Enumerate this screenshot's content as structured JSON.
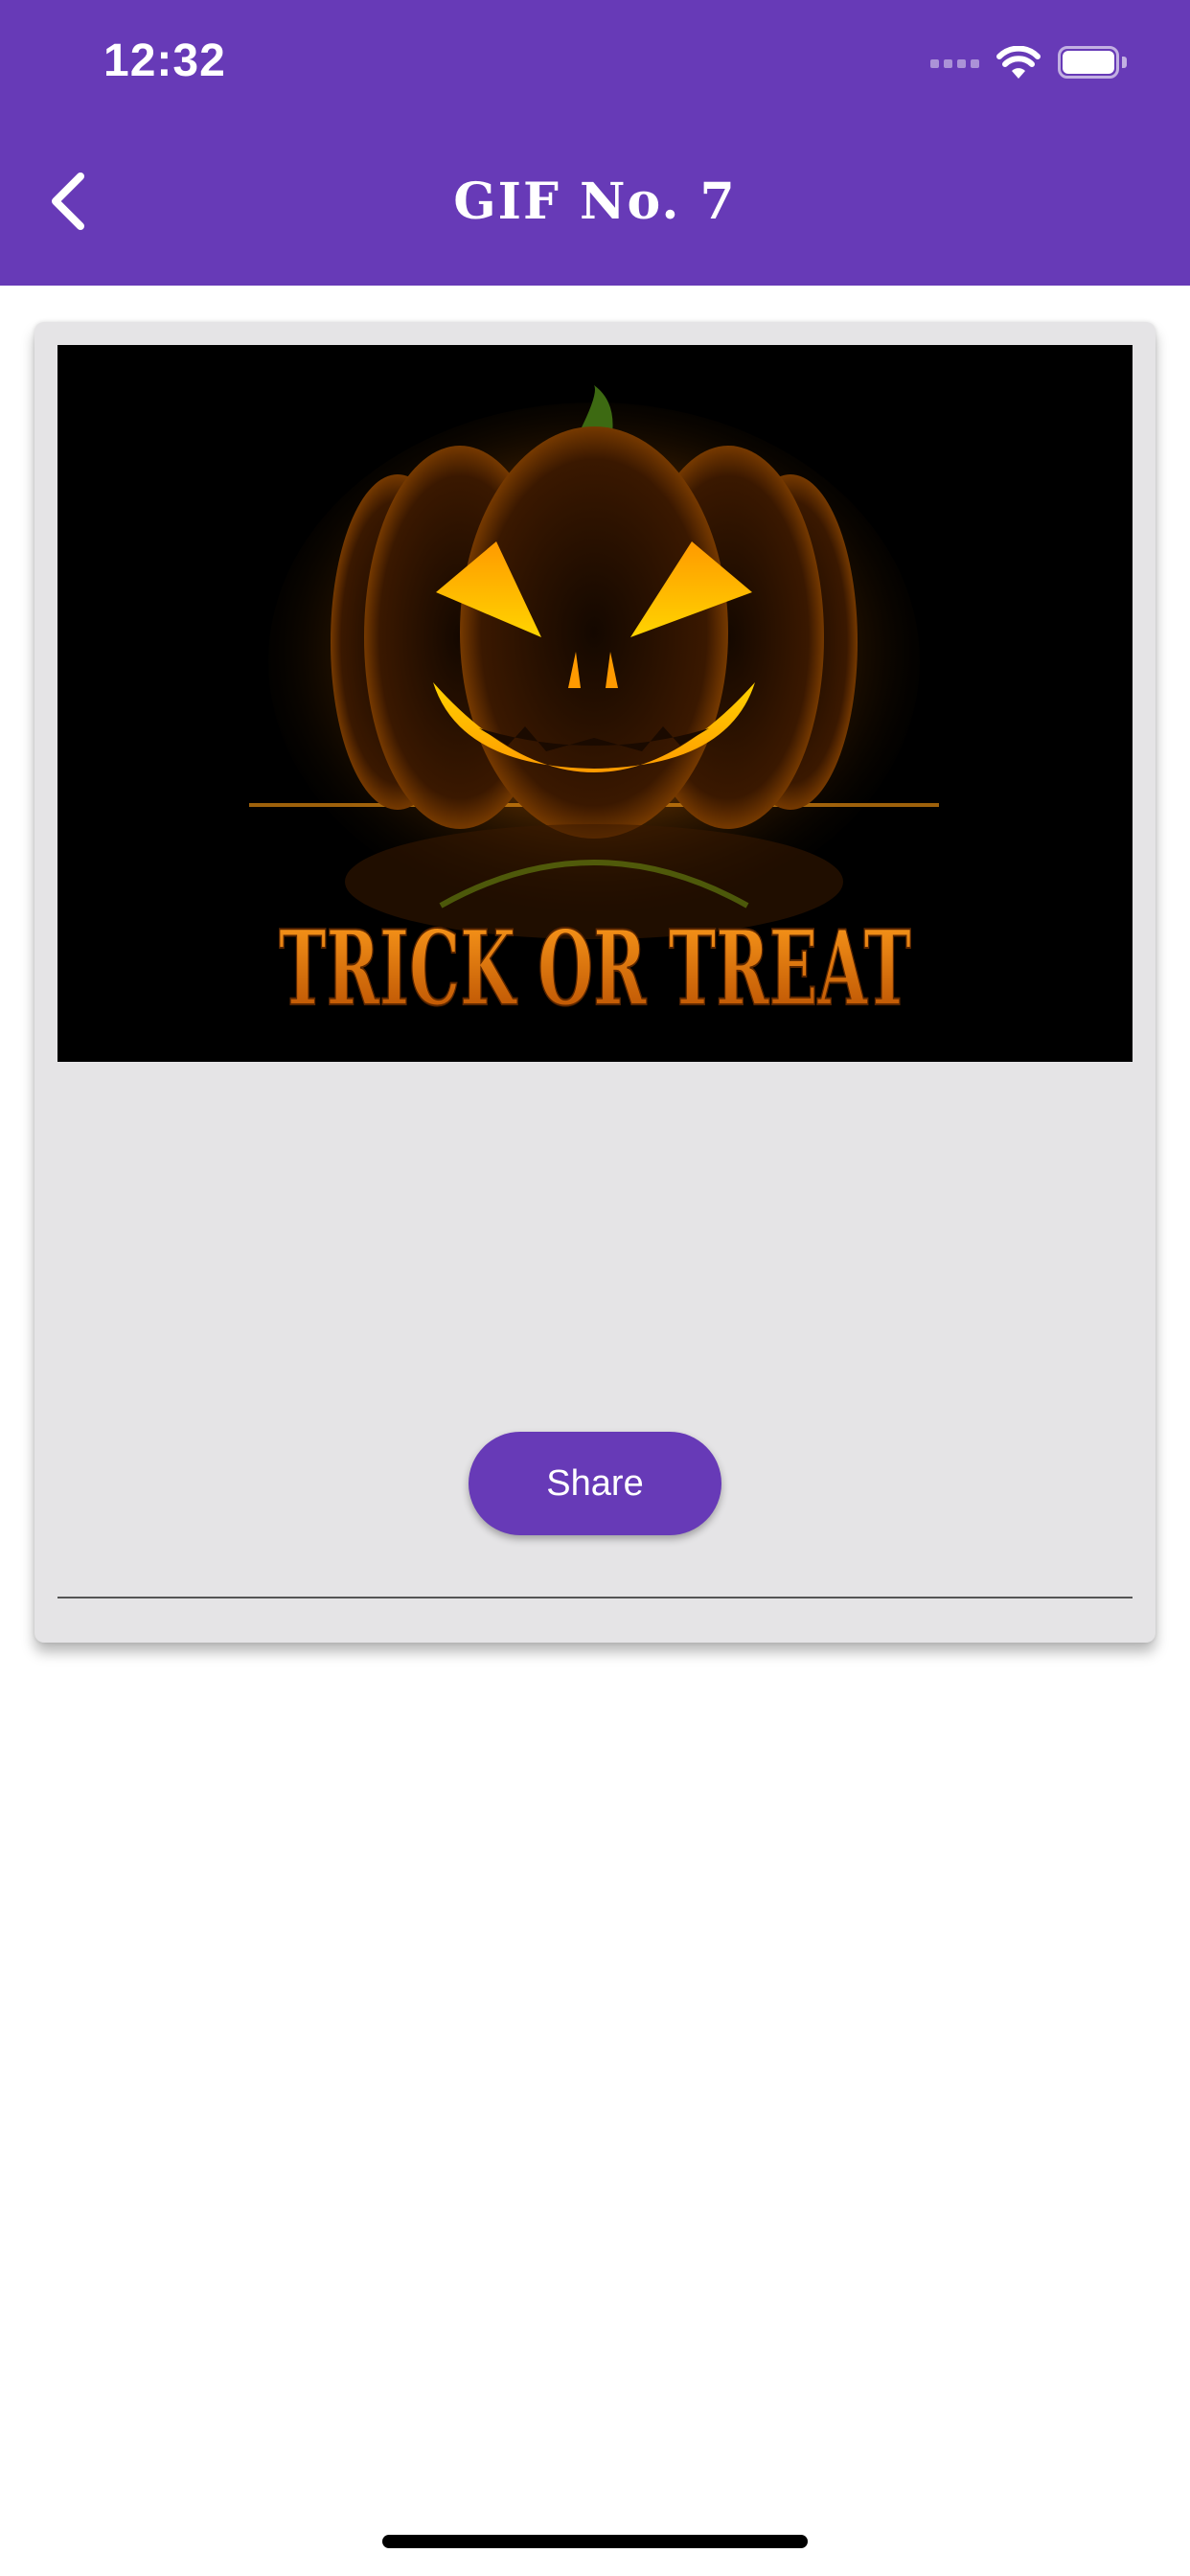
{
  "status_bar": {
    "time": "12:32"
  },
  "nav": {
    "title": "GIF No. 7",
    "back_icon": "chevron-left-icon"
  },
  "gif": {
    "caption": "TRICK OR TREAT"
  },
  "actions": {
    "share_label": "Share"
  },
  "colors": {
    "accent": "#673ab7",
    "card_background": "#e5e4e6",
    "page_background": "#ffffff"
  }
}
